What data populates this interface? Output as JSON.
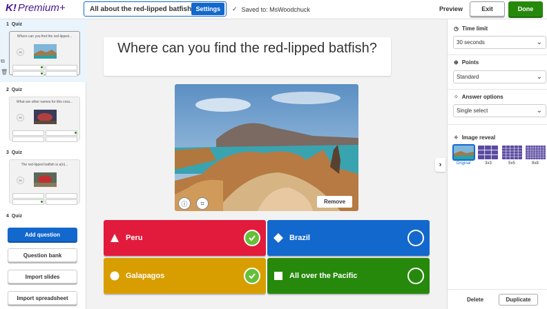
{
  "topbar": {
    "brand": "Premium+",
    "quiz_title": "All about the red-lipped batfish",
    "settings_label": "Settings",
    "saved_text": "Saved to: MsWoodchuck",
    "preview_label": "Preview",
    "exit_label": "Exit",
    "done_label": "Done"
  },
  "sidebar": {
    "slides": [
      {
        "number": "1",
        "type": "Quiz",
        "question": "Where can you find the red-lipped...",
        "timer": "30"
      },
      {
        "number": "2",
        "type": "Quiz",
        "question": "What are other names for this crea...",
        "timer": "30"
      },
      {
        "number": "3",
        "type": "Quiz",
        "question": "The red-lipped batfish is a(n)...",
        "timer": "30"
      },
      {
        "number": "4",
        "type": "Quiz"
      }
    ],
    "add_question": "Add question",
    "question_bank": "Question bank",
    "import_slides": "Import slides",
    "import_spreadsheet": "Import spreadsheet"
  },
  "editor": {
    "question": "Where can you find the red-lipped batfish?",
    "remove_label": "Remove",
    "answers": [
      {
        "text": "Peru",
        "color": "#e21b3c",
        "shape": "triangle",
        "correct": true
      },
      {
        "text": "Brazil",
        "color": "#1368ce",
        "shape": "diamond",
        "correct": false
      },
      {
        "text": "Galapagos",
        "color": "#d89e00",
        "shape": "circle",
        "correct": true
      },
      {
        "text": "All over the Pacific",
        "color": "#26890c",
        "shape": "square",
        "correct": false
      }
    ]
  },
  "rightpanel": {
    "time_limit_label": "Time limit",
    "time_limit_value": "30 seconds",
    "points_label": "Points",
    "points_value": "Standard",
    "answer_options_label": "Answer options",
    "answer_options_value": "Single select",
    "image_reveal_label": "Image reveal",
    "reveal_options": [
      "Original",
      "3x3",
      "5x5",
      "8x8"
    ],
    "delete_label": "Delete",
    "duplicate_label": "Duplicate"
  },
  "colors": {
    "accent": "#1368ce",
    "brand": "#46178f",
    "done": "#26890c"
  }
}
